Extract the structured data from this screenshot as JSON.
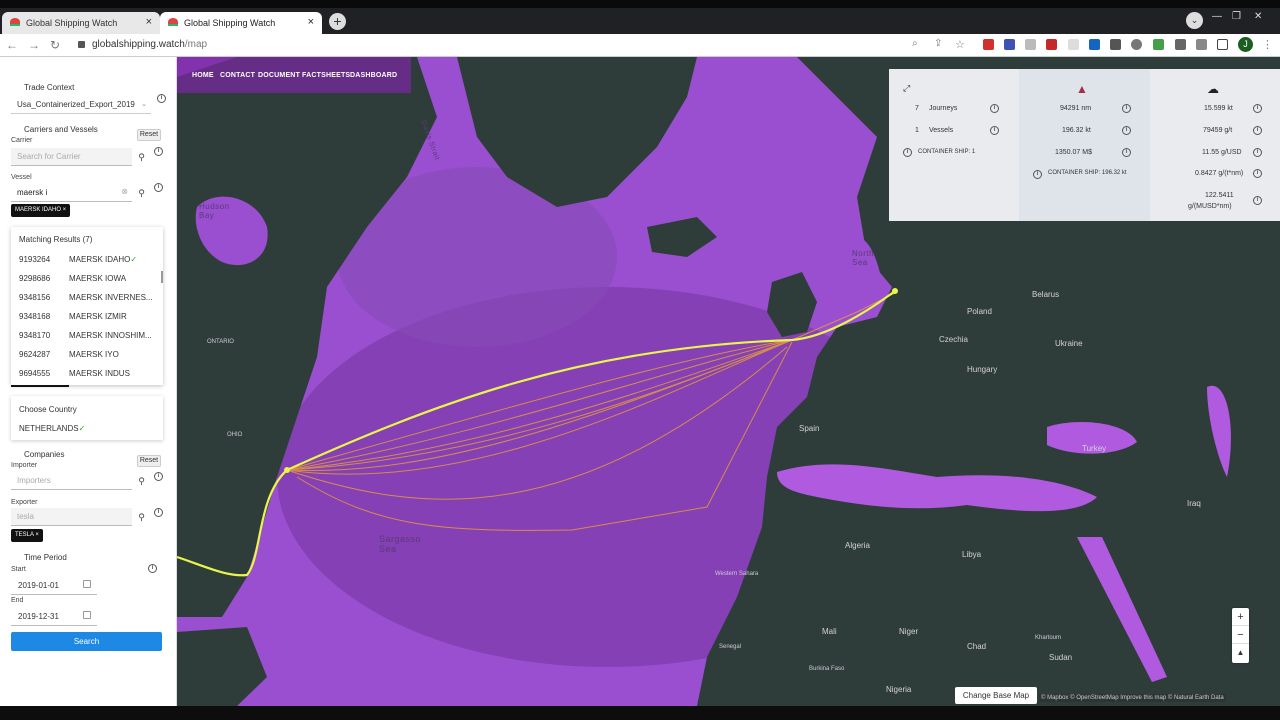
{
  "browser": {
    "tabs": [
      {
        "title": "Global Shipping Watch"
      },
      {
        "title": "Global Shipping Watch"
      }
    ],
    "new_tab_icon": "+",
    "url_host": "globalshipping.watch",
    "url_path": "/map",
    "profile_initial": "J"
  },
  "sidebar": {
    "trade_context_title": "Trade Context",
    "trade_context_value": "Usa_Containerized_Export_2019",
    "carriers_title": "Carriers and Vessels",
    "reset_label": "Reset",
    "carrier_label": "Carrier",
    "carrier_placeholder": "Search for Carrier",
    "vessel_label": "Vessel",
    "vessel_value": "maersk i",
    "vessel_chip": "MAERSK IDAHO ×",
    "matching_header": "Matching Results (7)",
    "matching_results": [
      {
        "mmsi": "9193264",
        "name": "MAERSK IDAHO",
        "check": "✓"
      },
      {
        "mmsi": "9298686",
        "name": "MAERSK IOWA",
        "check": ""
      },
      {
        "mmsi": "9348156",
        "name": "MAERSK INVERNES...",
        "check": ""
      },
      {
        "mmsi": "9348168",
        "name": "MAERSK IZMIR",
        "check": ""
      },
      {
        "mmsi": "9348170",
        "name": "MAERSK INNOSHIM...",
        "check": ""
      },
      {
        "mmsi": "9624287",
        "name": "MAERSK IYO",
        "check": ""
      },
      {
        "mmsi": "9694555",
        "name": "MAERSK INDUS",
        "check": ""
      }
    ],
    "choose_country_title": "Choose Country",
    "country_value": "NETHERLANDS",
    "country_check": "✓",
    "companies_title": "Companies",
    "importer_label": "Importer",
    "importer_placeholder": "Importers",
    "exporter_label": "Exporter",
    "exporter_value": "tesla",
    "exporter_chip": "TESLA ×",
    "time_period_title": "Time Period",
    "start_label": "Start",
    "start_value": "2019-01-01",
    "end_label": "End",
    "end_value": "2019-12-31",
    "search_button": "Search"
  },
  "map": {
    "nav": [
      "HOME",
      "CONTACT",
      "DOCUMENT",
      "FACTSHEETS",
      "DASHBOARD"
    ],
    "labels": {
      "hudson_bay": "Hudson\nBay",
      "davis_strait": "Davis Strait",
      "north_sea": "North\nSea",
      "sargasso_sea": "Sargasso\nSea",
      "ontario": "ONTARIO",
      "ohio": "OHIO",
      "spain": "Spain",
      "belarus": "Belarus",
      "poland": "Poland",
      "czechia": "Czechia",
      "ukraine": "Ukraine",
      "hungary": "Hungary",
      "turkey": "Turkey",
      "iraq": "Iraq",
      "algeria": "Algeria",
      "libya": "Libya",
      "western_sahara": "Western Sahara",
      "mali": "Mali",
      "niger": "Niger",
      "chad": "Chad",
      "sudan": "Sudan",
      "senegal": "Senegal",
      "burkina_faso": "Burkina Faso",
      "nigeria": "Nigeria",
      "khartoum": "Khartoum"
    },
    "stats": {
      "journeys_count": "7",
      "journeys_label": "Journeys",
      "vessels_count": "1",
      "vessels_label": "Vessels",
      "container_ship_count": "CONTAINER SHIP: 1",
      "distance": "94291 nm",
      "weight": "196.32 kt",
      "value": "1350.07 M$",
      "container_ship_weight": "CONTAINER SHIP: 196.32 kt",
      "co2": "15.599 kt",
      "g_per_t": "79459 g/t",
      "g_per_usd": "11.55 g/USD",
      "g_per_tnm": "0.8427 g/(t*nm)",
      "g_per_musd_nm_1": "122.5411",
      "g_per_musd_nm_2": "g/(MUSD*nm)"
    },
    "change_base_map": "Change Base Map",
    "attribution": "© Mapbox © OpenStreetMap Improve this map © Natural Earth Data",
    "zoom_in": "+",
    "zoom_out": "−",
    "compass": "▲"
  },
  "colors": {
    "ocean_shallow": "#b05ae0",
    "ocean_deep": "#7d3fa8",
    "land": "#2e3d3a",
    "route_primary": "#e8f54a",
    "route_secondary": "#e69a3a",
    "accent_button": "#1e88e5"
  }
}
